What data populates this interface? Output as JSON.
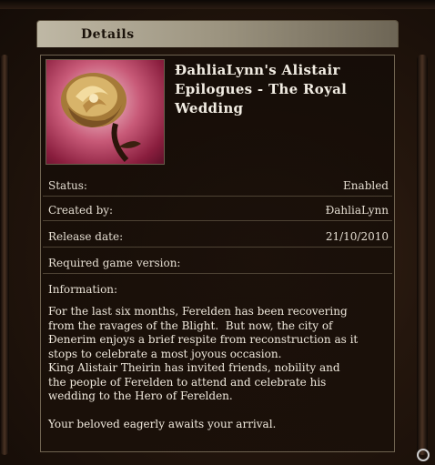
{
  "header": {
    "tab_label": "Details"
  },
  "details": {
    "title": "ĐahliaLynn's Alistair Epilogues - The Royal Wedding",
    "thumbnail_icon": "rose-icon",
    "rows": [
      {
        "label": "Status:",
        "value": "Enabled"
      },
      {
        "label": "Created by:",
        "value": "ĐahliaLynn"
      },
      {
        "label": "Release date:",
        "value": "21/10/2010"
      },
      {
        "label": "Required game version:",
        "value": ""
      },
      {
        "label": "Information:",
        "value": ""
      }
    ],
    "description": "For the last six months, Ferelden has been recovering\nfrom the ravages of the Blight.  But now, the city of\nĐenerim enjoys a brief respite from reconstruction as it\nstops to celebrate a most joyous occasion.\nKing Alistair Theirin has invited friends, nobility and\nthe people of Ferelden to attend and celebrate his\nwedding to the Hero of Ferelden.\n\nYour beloved eagerly awaits your arrival."
  },
  "colors": {
    "panel_border": "#6f6350",
    "text": "#efe8dc",
    "tab": "#bfb8a5"
  }
}
